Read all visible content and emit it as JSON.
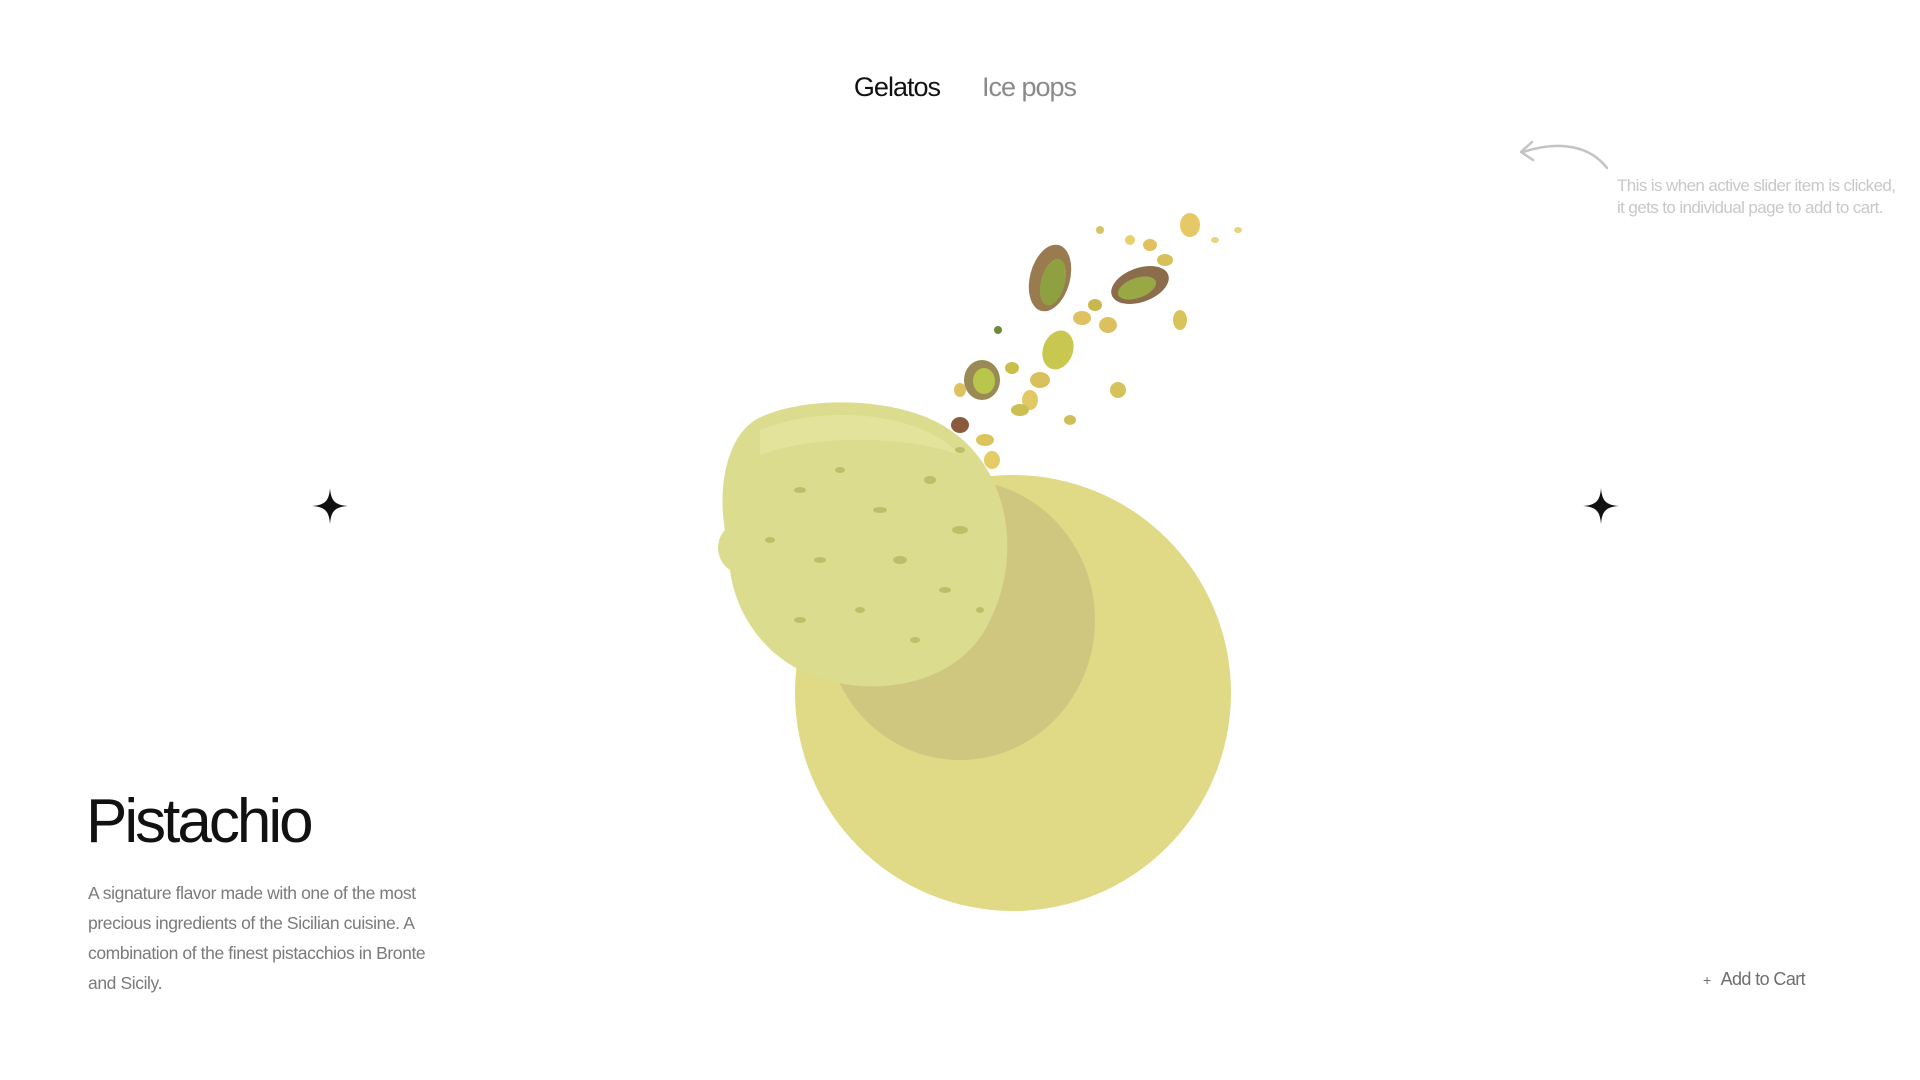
{
  "nav": {
    "tabs": [
      {
        "label": "Gelatos",
        "active": true
      },
      {
        "label": "Ice pops",
        "active": false
      }
    ]
  },
  "annotation": {
    "text": "This is when active slider item is clicked, it gets to individual page to add to cart.",
    "icon": "curved-arrow-icon",
    "color": "#c8c8c8"
  },
  "slider": {
    "prev_icon": "sparkle-icon",
    "next_icon": "sparkle-icon"
  },
  "product": {
    "name": "Pistachio",
    "description": "A signature flavor made with one of the most precious ingredients of the Sicilian cuisine. A combination of the finest pistacchios in Bronte and Sicily.",
    "image": "pistachio-gelato-scoop",
    "backdrop_color": "#e0d985",
    "scoop_color": "#dcdc8e"
  },
  "cart": {
    "label": "Add to Cart",
    "icon": "plus-icon"
  }
}
